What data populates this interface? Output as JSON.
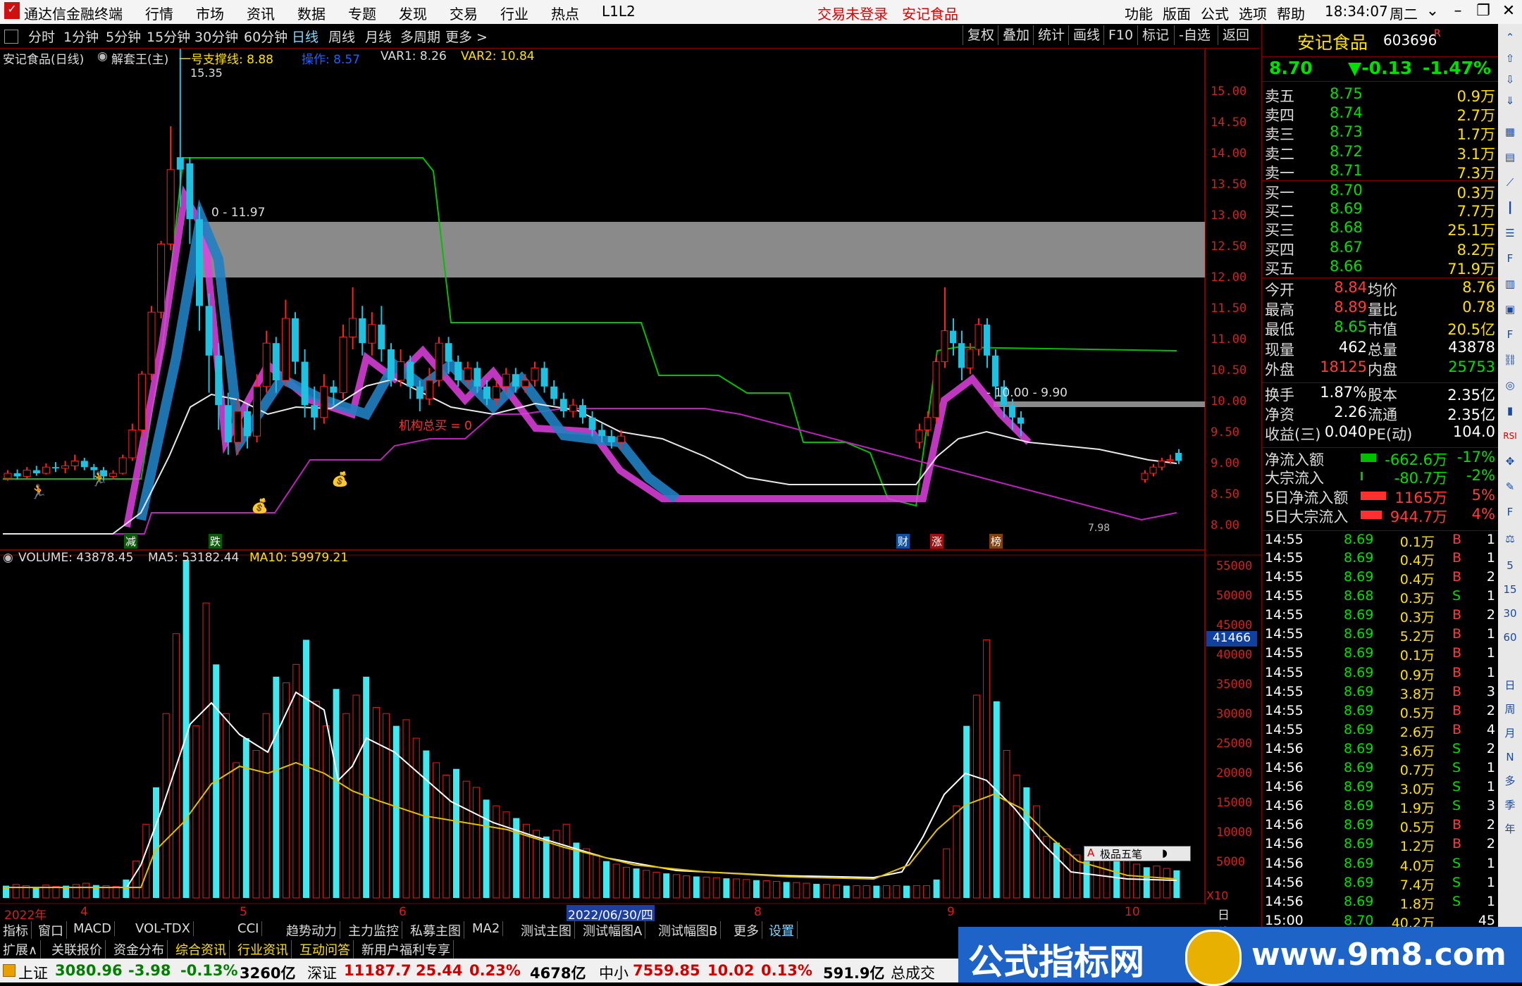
{
  "window": {
    "app_title": "通达信金融终端",
    "menu": [
      "行情",
      "市场",
      "资讯",
      "数据",
      "专题",
      "发现",
      "交易",
      "行业",
      "热点",
      "L1L2"
    ],
    "status_login": "交易未登录",
    "status_stock": "安记食品",
    "right_menu": [
      "功能",
      "版面",
      "公式",
      "选项",
      "帮助"
    ],
    "time": "18:34:07",
    "weekday": "周二"
  },
  "toolbar": {
    "periods": [
      "分时",
      "1分钟",
      "5分钟",
      "15分钟",
      "30分钟",
      "60分钟",
      "日线",
      "周线",
      "月线",
      "多周期",
      "更多 >"
    ],
    "active_period": "日线",
    "right_buttons": [
      "复权",
      "叠加",
      "统计",
      "画线",
      "F10",
      "标记",
      "-自选",
      "返回"
    ]
  },
  "legend": {
    "title": "安记食品(日线)",
    "indicator": "解套王(主)",
    "support": "一号支撑线: 8.88",
    "operate": "操作: 8.57",
    "var1": "VAR1: 8.26",
    "var2": "VAR2: 10.84"
  },
  "main_chart": {
    "price_labels": [
      "15.00",
      "14.50",
      "14.00",
      "13.50",
      "13.00",
      "12.50",
      "12.00",
      "11.50",
      "11.00",
      "10.50",
      "10.00",
      "9.50",
      "9.00",
      "8.50",
      "8.00"
    ],
    "peak_label": "15.35",
    "band_label_1": "0 - 11.97",
    "band_label_2": "- 10.00 - 9.90",
    "annotation": "机构总买 = 0",
    "bottom_markers": [
      "减",
      "跌",
      "财",
      "涨",
      "榜"
    ],
    "low_label": "7.98"
  },
  "volume_chart": {
    "legend_volume": "VOLUME: 43878.45",
    "legend_ma5": "MA5: 53182.44",
    "legend_ma10": "MA10: 59979.21",
    "axis_labels": [
      "55000",
      "50000",
      "45000",
      "40000",
      "35000",
      "30000",
      "25000",
      "20000",
      "15000",
      "10000",
      "5000"
    ],
    "current_tag": "41466",
    "unit": "X10",
    "mini_widget": "极品五笔"
  },
  "date_axis": {
    "labels": [
      "2022年",
      "4",
      "5",
      "6",
      "2022/06/30/四",
      "8",
      "9",
      "10"
    ],
    "period": "日线"
  },
  "quote": {
    "name": "安记食品",
    "code": "603696",
    "badge": "R",
    "price": "8.70",
    "change": "▼-0.13",
    "change_pct": "-1.47%",
    "asks": [
      {
        "label": "卖五",
        "price": "8.75",
        "vol": "0.9万"
      },
      {
        "label": "卖四",
        "price": "8.74",
        "vol": "2.7万"
      },
      {
        "label": "卖三",
        "price": "8.73",
        "vol": "1.7万"
      },
      {
        "label": "卖二",
        "price": "8.72",
        "vol": "3.1万"
      },
      {
        "label": "卖一",
        "price": "8.71",
        "vol": "7.3万"
      }
    ],
    "bids": [
      {
        "label": "买一",
        "price": "8.70",
        "vol": "0.3万"
      },
      {
        "label": "买二",
        "price": "8.69",
        "vol": "7.7万"
      },
      {
        "label": "买三",
        "price": "8.68",
        "vol": "25.1万"
      },
      {
        "label": "买四",
        "price": "8.67",
        "vol": "8.2万"
      },
      {
        "label": "买五",
        "price": "8.66",
        "vol": "71.9万"
      }
    ],
    "stats": [
      {
        "l1": "今开",
        "v1": "8.84",
        "l2": "均价",
        "v2": "8.76"
      },
      {
        "l1": "最高",
        "v1": "8.89",
        "l2": "量比",
        "v2": "0.78"
      },
      {
        "l1": "最低",
        "v1": "8.65",
        "l2": "市值",
        "v2": "20.5亿"
      },
      {
        "l1": "现量",
        "v1": "462",
        "l2": "总量",
        "v2": "43878"
      },
      {
        "l1": "外盘",
        "v1": "18125",
        "l2": "内盘",
        "v2": "25753"
      }
    ],
    "stats2": [
      {
        "l1": "换手",
        "v1": "1.87%",
        "l2": "股本",
        "v2": "2.35亿"
      },
      {
        "l1": "净资",
        "v1": "2.26",
        "l2": "流通",
        "v2": "2.35亿"
      },
      {
        "l1": "收益(三)",
        "v1": "0.040",
        "l2": "PE(动)",
        "v2": "104.0"
      }
    ],
    "flows": [
      {
        "label": "净流入额",
        "value": "-662.6万",
        "pct": "-17%"
      },
      {
        "label": "大宗流入",
        "value": "-80.7万",
        "pct": "-2%"
      },
      {
        "label": "5日净流入额",
        "value": "1165万",
        "pct": "5%"
      },
      {
        "label": "5日大宗流入",
        "value": "944.7万",
        "pct": "4%"
      }
    ],
    "ticks": [
      {
        "t": "14:55",
        "p": "8.69",
        "v": "0.1万",
        "d": "B",
        "n": "1"
      },
      {
        "t": "14:55",
        "p": "8.69",
        "v": "0.4万",
        "d": "B",
        "n": "1"
      },
      {
        "t": "14:55",
        "p": "8.69",
        "v": "0.4万",
        "d": "B",
        "n": "2"
      },
      {
        "t": "14:55",
        "p": "8.68",
        "v": "0.3万",
        "d": "S",
        "n": "1"
      },
      {
        "t": "14:55",
        "p": "8.69",
        "v": "0.3万",
        "d": "B",
        "n": "2"
      },
      {
        "t": "14:55",
        "p": "8.69",
        "v": "5.2万",
        "d": "B",
        "n": "1"
      },
      {
        "t": "14:55",
        "p": "8.69",
        "v": "0.1万",
        "d": "B",
        "n": "1"
      },
      {
        "t": "14:55",
        "p": "8.69",
        "v": "0.9万",
        "d": "B",
        "n": "1"
      },
      {
        "t": "14:55",
        "p": "8.69",
        "v": "3.8万",
        "d": "B",
        "n": "3"
      },
      {
        "t": "14:55",
        "p": "8.69",
        "v": "0.5万",
        "d": "B",
        "n": "2"
      },
      {
        "t": "14:55",
        "p": "8.69",
        "v": "2.6万",
        "d": "B",
        "n": "4"
      },
      {
        "t": "14:56",
        "p": "8.69",
        "v": "3.6万",
        "d": "S",
        "n": "2"
      },
      {
        "t": "14:56",
        "p": "8.69",
        "v": "0.7万",
        "d": "S",
        "n": "1"
      },
      {
        "t": "14:56",
        "p": "8.69",
        "v": "3.0万",
        "d": "S",
        "n": "1"
      },
      {
        "t": "14:56",
        "p": "8.69",
        "v": "1.9万",
        "d": "S",
        "n": "3"
      },
      {
        "t": "14:56",
        "p": "8.69",
        "v": "0.5万",
        "d": "B",
        "n": "2"
      },
      {
        "t": "14:56",
        "p": "8.69",
        "v": "1.2万",
        "d": "B",
        "n": "2"
      },
      {
        "t": "14:56",
        "p": "8.69",
        "v": "4.0万",
        "d": "S",
        "n": "1"
      },
      {
        "t": "14:56",
        "p": "8.69",
        "v": "7.4万",
        "d": "S",
        "n": "1"
      },
      {
        "t": "14:56",
        "p": "8.69",
        "v": "1.8万",
        "d": "S",
        "n": "1"
      },
      {
        "t": "15:00",
        "p": "8.70",
        "v": "40.2万",
        "d": "",
        "n": "45"
      }
    ]
  },
  "sidebar_labels": [
    "RSI",
    "5",
    "15",
    "30",
    "60",
    "日",
    "周",
    "月",
    "N",
    "多",
    "季",
    "年"
  ],
  "tabs1": [
    "指标",
    "窗口",
    "MACD",
    "VOL-TDX",
    "CCI",
    "趋势动力",
    "主力监控",
    "私募主图",
    "MA2",
    "测试主图",
    "测试幅图A",
    "测试幅图B",
    "更多",
    "设置"
  ],
  "tabs2": [
    "扩展∧",
    "关联报价",
    "资金分布",
    "综合资讯",
    "行业资讯",
    "互动问答",
    "新用户福利专享"
  ],
  "statusbar": {
    "sh_label": "上证",
    "sh_val": "3080.96",
    "sh_chg": "-3.98",
    "sh_pct": "-0.13%",
    "sh_amt": "3260亿",
    "sz_label": "深证",
    "sz_val": "11187.7",
    "sz_chg": "25.44",
    "sz_pct": "0.23%",
    "sz_amt": "4678亿",
    "zx_label": "中小",
    "zx_val": "7559.85",
    "zx_chg": "10.02",
    "zx_pct": "0.13%",
    "zx_amt": "591.9亿",
    "total_label": "总成交"
  },
  "banner": {
    "text": "公式指标网",
    "url": "www.9m8.com"
  }
}
